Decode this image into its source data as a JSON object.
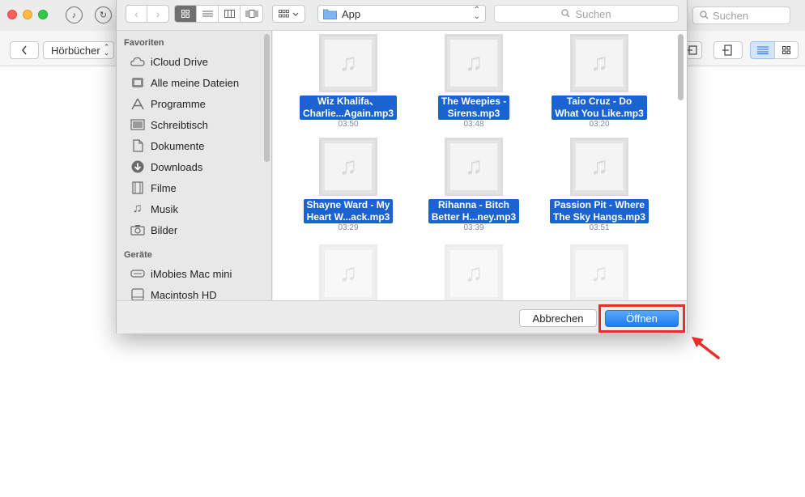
{
  "app": {
    "search_placeholder": "Suchen",
    "category_select": "Hörbücher"
  },
  "dialog": {
    "location": "App",
    "search_placeholder": "Suchen",
    "sidebar": {
      "favorites_header": "Favoriten",
      "favorites": [
        {
          "label": "iCloud Drive",
          "icon": "cloud-icon"
        },
        {
          "label": "Alle meine Dateien",
          "icon": "all-files-icon"
        },
        {
          "label": "Programme",
          "icon": "applications-icon"
        },
        {
          "label": "Schreibtisch",
          "icon": "desktop-icon"
        },
        {
          "label": "Dokumente",
          "icon": "document-icon"
        },
        {
          "label": "Downloads",
          "icon": "download-icon"
        },
        {
          "label": "Filme",
          "icon": "film-icon"
        },
        {
          "label": "Musik",
          "icon": "music-icon"
        },
        {
          "label": "Bilder",
          "icon": "camera-icon"
        }
      ],
      "devices_header": "Geräte",
      "devices": [
        {
          "label": "iMobies Mac mini",
          "icon": "mac-mini-icon"
        },
        {
          "label": "Macintosh HD",
          "icon": "hard-disk-icon"
        }
      ]
    },
    "files": [
      {
        "name_line1": "Wiz Khalifa、",
        "name_line2": "Charlie...Again.mp3",
        "duration": "03:50"
      },
      {
        "name_line1": "The Weepies -",
        "name_line2": "Sirens.mp3",
        "duration": "03:48"
      },
      {
        "name_line1": "Taio Cruz - Do",
        "name_line2": "What You Like.mp3",
        "duration": "03:20"
      },
      {
        "name_line1": "Shayne Ward - My",
        "name_line2": "Heart W...ack.mp3",
        "duration": "03:29"
      },
      {
        "name_line1": "Rihanna - Bitch",
        "name_line2": "Better H...ney.mp3",
        "duration": "03:39"
      },
      {
        "name_line1": "Passion Pit - Where",
        "name_line2": "The Sky Hangs.mp3",
        "duration": "03:51"
      }
    ],
    "cancel_label": "Abbrechen",
    "open_label": "Öffnen"
  },
  "colors": {
    "selection": "#1a63d0",
    "primary_button": "#1d7bf3",
    "highlight": "#e5302a"
  }
}
